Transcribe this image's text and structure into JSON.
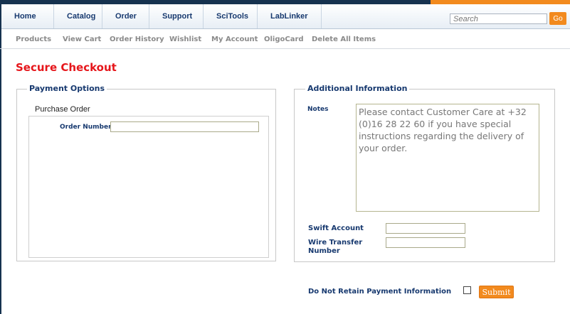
{
  "colors": {
    "accent": "#f28a1e",
    "nav_dark": "#16324f",
    "link": "#17396f",
    "title_red": "#e6161b"
  },
  "nav": {
    "items": [
      "Home",
      "Catalog",
      "Order",
      "Support",
      "SciTools",
      "LabLinker"
    ],
    "search_placeholder": "Search",
    "go_label": "Go"
  },
  "subnav": {
    "items": [
      "Products",
      "View Cart",
      "Order History",
      "Wishlist",
      "My Account",
      "OligoCard",
      "Delete All Items"
    ]
  },
  "page": {
    "title": "Secure Checkout"
  },
  "payment": {
    "legend": "Payment Options",
    "method": "Purchase Order",
    "order_number_label": "Order Number:",
    "order_number_value": ""
  },
  "additional": {
    "legend": "Additional Information",
    "notes_label": "Notes",
    "notes_text": "Please contact Customer Care at +32 (0)16 28 22 60 if you have special instructions regarding the delivery of your order.",
    "swift_label": "Swift Account",
    "swift_value": "",
    "wire_label_line1": "Wire Transfer",
    "wire_label_line2": "Number",
    "wire_value": ""
  },
  "footer": {
    "retain_label": "Do Not Retain Payment Information",
    "retain_checked": false,
    "submit_label": "Submit"
  }
}
